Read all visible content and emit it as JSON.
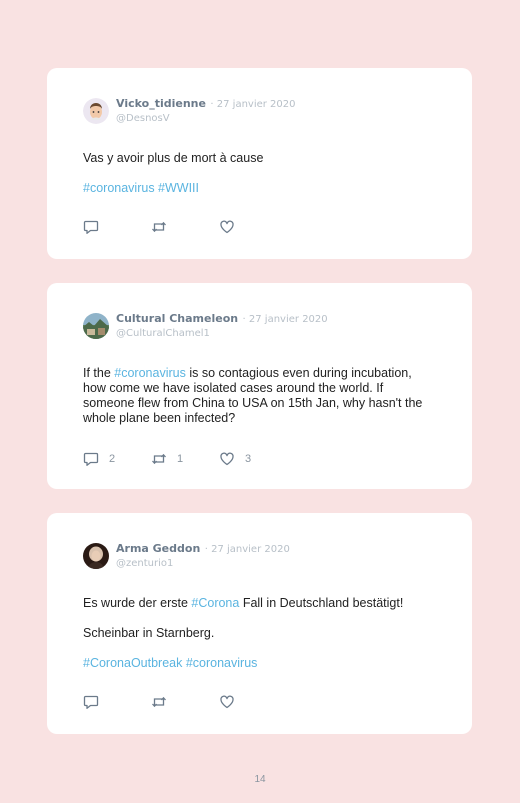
{
  "page_number": "14",
  "colors": {
    "background": "#f9e2e2",
    "hashtag": "#5ab4e0",
    "name": "#6b7a8a"
  },
  "tweets": [
    {
      "name": "Vicko_tidienne",
      "date": "· 27 janvier 2020",
      "handle": "@DesnosV",
      "avatar_icon": "memoji-avatar",
      "text1": "Vas y avoir plus de mort à cause",
      "hashtags": "#coronavirus #WWIII",
      "replies": "",
      "retweets": "",
      "likes": ""
    },
    {
      "name": "Cultural Chameleon",
      "date": "· 27 janvier 2020",
      "handle": "@CulturalChamel1",
      "avatar_icon": "landscape-avatar",
      "text_pre": "If the ",
      "text_tag": "#coronavirus",
      "text_post": " is so contagious even during incubation, how come we have isolated cases around the world. If someone flew from China to USA on 15th Jan, why hasn't the whole plane been infected?",
      "replies": "2",
      "retweets": "1",
      "likes": "3"
    },
    {
      "name": "Arma Geddon",
      "date": "· 27 janvier 2020",
      "handle": "@zenturio1",
      "avatar_icon": "portrait-avatar",
      "text_pre": "Es wurde der erste ",
      "text_tag": "#Corona",
      "text_post": " Fall in Deutschland bestätigt!",
      "text2": "Scheinbar in Starnberg.",
      "hashtags": "#CoronaOutbreak #coronavirus",
      "replies": "",
      "retweets": "",
      "likes": ""
    }
  ]
}
